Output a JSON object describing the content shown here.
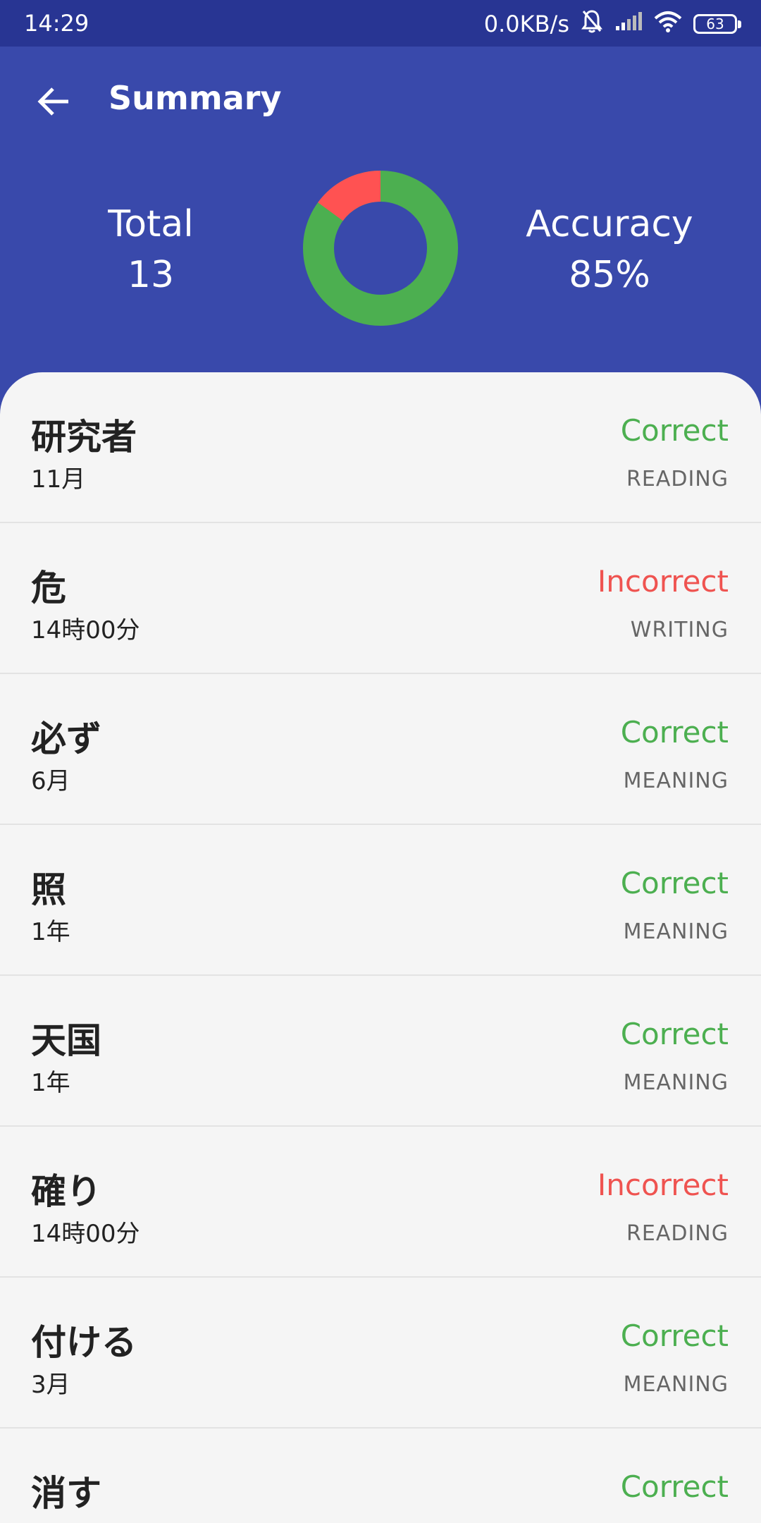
{
  "status_bar": {
    "time": "14:29",
    "net_speed": "0.0KB/s",
    "battery": "63",
    "icons": [
      "bell-off-icon",
      "signal-icon",
      "wifi-icon",
      "battery-icon"
    ]
  },
  "appbar": {
    "title": "Summary",
    "back_icon": "arrow-left-icon"
  },
  "summary": {
    "total_label": "Total",
    "total_value": "13",
    "accuracy_label": "Accuracy",
    "accuracy_value": "85%"
  },
  "donut": {
    "correct_fraction": 0.85,
    "incorrect_fraction": 0.15,
    "correct_color": "#4caf50",
    "incorrect_color": "#ff5252"
  },
  "colors": {
    "primary": "#3949ab",
    "status_bar": "#283593",
    "correct": "#4caf50",
    "incorrect": "#ef5350",
    "list_bg": "#f5f5f5"
  },
  "items": [
    {
      "word": "研究者",
      "sub": "11月",
      "result": "Correct",
      "kind": "READING",
      "correct": true
    },
    {
      "word": "危",
      "sub": "14時00分",
      "result": "Incorrect",
      "kind": "WRITING",
      "correct": false
    },
    {
      "word": "必ず",
      "sub": "6月",
      "result": "Correct",
      "kind": "MEANING",
      "correct": true
    },
    {
      "word": "照",
      "sub": "1年",
      "result": "Correct",
      "kind": "MEANING",
      "correct": true
    },
    {
      "word": "天国",
      "sub": "1年",
      "result": "Correct",
      "kind": "MEANING",
      "correct": true
    },
    {
      "word": "確り",
      "sub": "14時00分",
      "result": "Incorrect",
      "kind": "READING",
      "correct": false
    },
    {
      "word": "付ける",
      "sub": "3月",
      "result": "Correct",
      "kind": "MEANING",
      "correct": true
    },
    {
      "word": "消す",
      "sub": "",
      "result": "Correct",
      "kind": "",
      "correct": true
    }
  ]
}
